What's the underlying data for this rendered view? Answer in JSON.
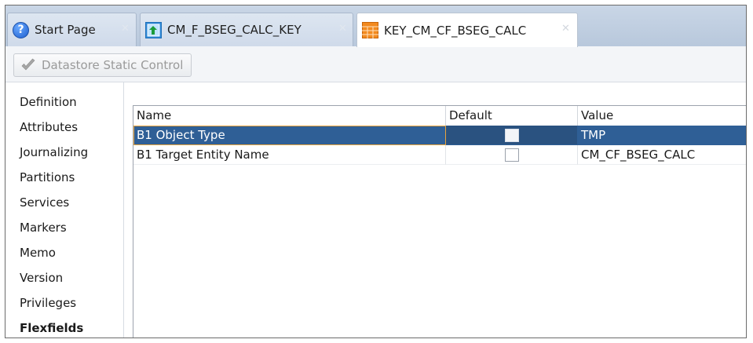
{
  "tabs": [
    {
      "label": "Start Page",
      "icon": "help-icon",
      "active": false
    },
    {
      "label": "CM_F_BSEG_CALC_KEY",
      "icon": "entity-icon",
      "active": false
    },
    {
      "label": "KEY_CM_CF_BSEG_CALC",
      "icon": "table-icon",
      "active": true
    }
  ],
  "toolbar": {
    "datastore_button": "Datastore Static Control"
  },
  "sidebar": {
    "items": [
      {
        "label": "Definition"
      },
      {
        "label": "Attributes"
      },
      {
        "label": "Journalizing"
      },
      {
        "label": "Partitions"
      },
      {
        "label": "Services"
      },
      {
        "label": "Markers"
      },
      {
        "label": "Memo"
      },
      {
        "label": "Version"
      },
      {
        "label": "Privileges"
      },
      {
        "label": "Flexfields"
      }
    ],
    "active": "Flexfields"
  },
  "grid": {
    "columns": [
      "Name",
      "Default",
      "Value"
    ],
    "rows": [
      {
        "name": "B1 Object Type",
        "default": false,
        "value": "TMP",
        "selected": true
      },
      {
        "name": "B1 Target Entity Name",
        "default": false,
        "value": "CM_CF_BSEG_CALC",
        "selected": false
      }
    ]
  },
  "colors": {
    "selection": "#2f5f96",
    "tab_bar": "#c9d6e6"
  }
}
